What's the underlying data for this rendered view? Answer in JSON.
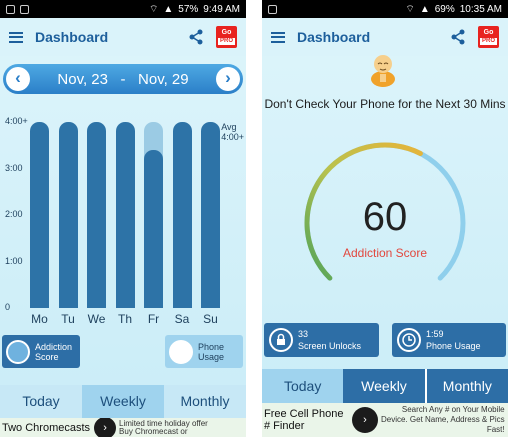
{
  "left": {
    "status": {
      "battery": "57%",
      "time": "9:49 AM"
    },
    "appbar": {
      "title": "Dashboard",
      "menu_icon": "menu-icon",
      "share_icon": "share-icon",
      "gopro_label": "Go",
      "gopro_sub": "PRO"
    },
    "date_range": {
      "prev": "‹",
      "next": "›",
      "start": "Nov, 23",
      "separator": "-",
      "end": "Nov, 29"
    },
    "chart_data": {
      "type": "bar",
      "categories": [
        "Mo",
        "Tu",
        "We",
        "Th",
        "Fr",
        "Sa",
        "Su"
      ],
      "values": [
        4,
        4,
        4,
        4,
        3.4,
        4,
        4
      ],
      "y_ticks": [
        "0",
        "1:00",
        "2:00",
        "3:00",
        "4:00+"
      ],
      "ylim": [
        0,
        4
      ],
      "avg_label": "Avg",
      "avg_value": "4:00+"
    },
    "legend": {
      "addiction": "Addiction Score",
      "usage": "Phone Usage"
    },
    "tabs": [
      "Today",
      "Weekly",
      "Monthly"
    ],
    "ad": {
      "title": "Two Chromecasts",
      "text1": "Limited time holiday offer",
      "text2": "Buy Chromecast or"
    }
  },
  "right": {
    "status": {
      "battery": "69%",
      "time": "10:35 AM"
    },
    "appbar": {
      "title": "Dashboard",
      "gopro_label": "Go",
      "gopro_sub": "PRO"
    },
    "headline": "Don't Check Your Phone for the Next 30 Mins",
    "score": "60",
    "score_label": "Addiction Score",
    "score_fraction": 0.6,
    "stats": {
      "unlocks_value": "33",
      "unlocks_label": "Screen Unlocks",
      "usage_value": "1:59",
      "usage_label": "Phone Usage"
    },
    "tabs": [
      "Today",
      "Weekly",
      "Monthly"
    ],
    "ad": {
      "title": "Free Cell Phone # Finder",
      "text1": "Search Any # on Your Mobile",
      "text2": "Device. Get Name, Address & Pics",
      "text3": "Fast!"
    }
  }
}
